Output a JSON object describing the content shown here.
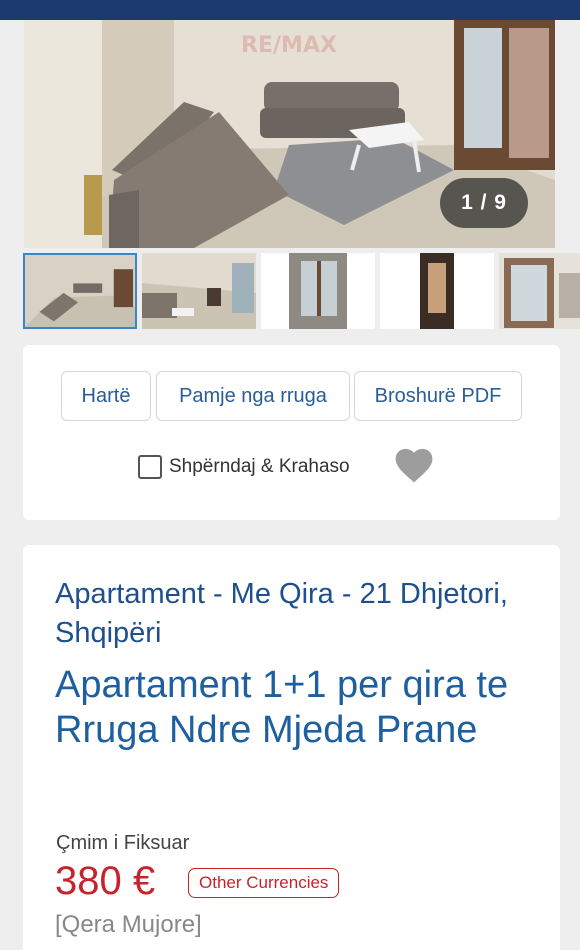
{
  "gallery": {
    "counter": "1 / 9",
    "watermark": "RE/MAX",
    "thumbnail_count": 5
  },
  "actions": {
    "map_label": "Hartë",
    "street_view_label": "Pamje nga rruga",
    "brochure_label": "Broshurë PDF",
    "share_compare_label": "Shpërndaj & Krahaso",
    "favorite_icon": "heart-icon"
  },
  "listing": {
    "subtitle": "Apartament - Me Qira - 21 Dhjetori, Shqipëri",
    "title": "Apartament 1+1 per qira te Rruga Ndre Mjeda Prane",
    "price_label": "Çmim i Fiksuar",
    "price": "380 €",
    "other_currencies_label": "Other Currencies",
    "period": "[Qera Mujore]"
  },
  "colors": {
    "brand_navy": "#1d3a6e",
    "link_blue": "#1e5fa0",
    "price_red": "#c8232c",
    "active_thumb_border": "#3a86c8"
  }
}
